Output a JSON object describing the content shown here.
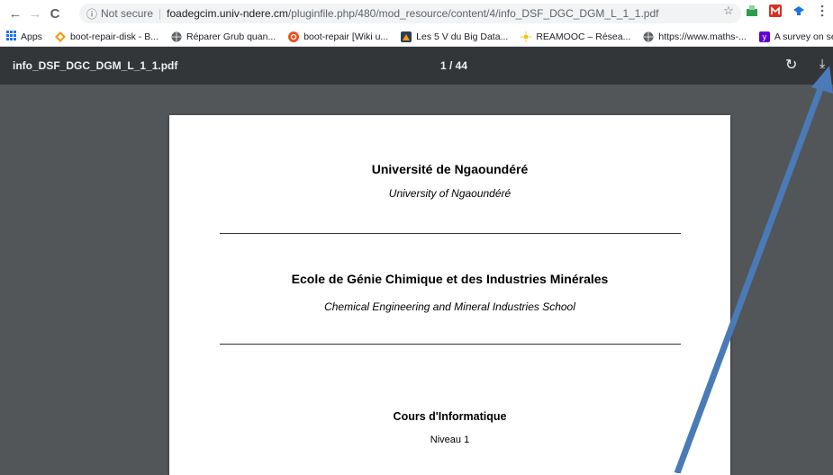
{
  "browser": {
    "back": "←",
    "forward": "→",
    "reload": "C",
    "security_icon": "ⓘ",
    "security_text": "Not secure",
    "url_host": "foadegcim.univ-ndere.cm",
    "url_path": "/pluginfile.php/480/mod_resource/content/4/info_DSF_DGC_DGM_L_1_1.pdf",
    "star": "☆"
  },
  "bookmarks": [
    {
      "label": "Apps",
      "icon": "apps-grid-icon",
      "color": "#1a73e8"
    },
    {
      "label": "boot-repair-disk - B...",
      "icon": "diamond-icon",
      "color": "#f39c12"
    },
    {
      "label": "Réparer Grub quan...",
      "icon": "globe-icon",
      "color": "#5f6368"
    },
    {
      "label": "boot-repair [Wiki u...",
      "icon": "ubuntu-icon",
      "color": "#e95420"
    },
    {
      "label": "Les 5 V du Big Data...",
      "icon": "page-icon",
      "color": "#2c3e50"
    },
    {
      "label": "REAMOOC – Résea...",
      "icon": "sun-icon",
      "color": "#f1c40f"
    },
    {
      "label": "https://www.maths-...",
      "icon": "globe-icon",
      "color": "#5f6368"
    },
    {
      "label": "A survey on securit...",
      "icon": "yahoo-icon",
      "color": "#6001d2"
    }
  ],
  "pdf": {
    "filename": "info_DSF_DGC_DGM_L_1_1.pdf",
    "page_indicator": "1 / 44",
    "rotate_icon": "↻",
    "download_icon": "⤓"
  },
  "document": {
    "university_fr": "Université de Ngaoundéré",
    "university_en": "University of Ngaoundéré",
    "school_fr": "Ecole de Génie Chimique et des Industries Minérales",
    "school_en": "Chemical Engineering and Mineral Industries School",
    "course": "Cours d'Informatique",
    "level": "Niveau 1"
  },
  "annotation": {
    "arrow_color": "#4a7ab8"
  }
}
